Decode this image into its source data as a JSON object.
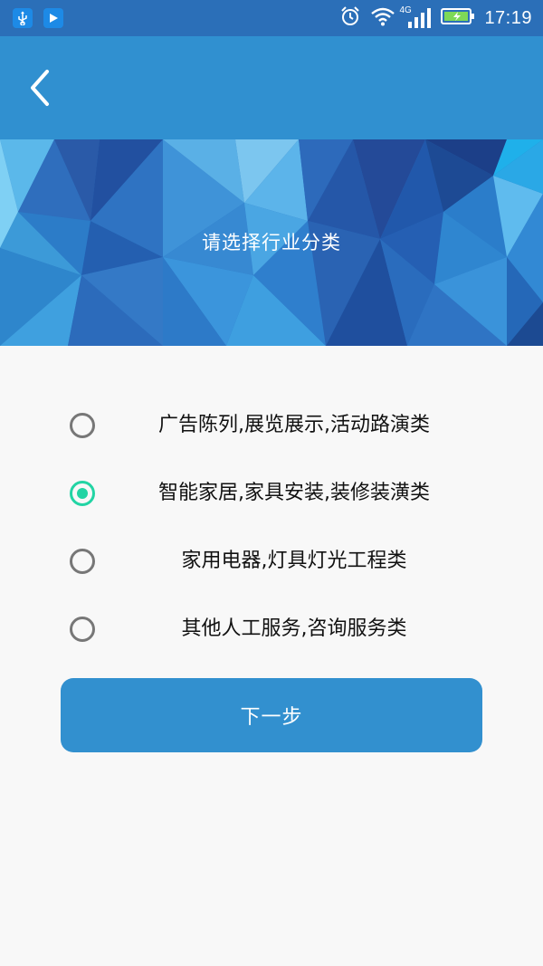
{
  "status_bar": {
    "time": "17:19",
    "network": "4G",
    "icons": [
      "usb-icon",
      "play-store-icon",
      "alarm-icon",
      "wifi-icon",
      "signal-icon",
      "battery-charging-icon"
    ]
  },
  "app_bar": {
    "back_icon": "chevron-left-icon"
  },
  "banner": {
    "title": "请选择行业分类"
  },
  "options": [
    {
      "label": "广告陈列,展览展示,活动路演类",
      "checked": false
    },
    {
      "label": "智能家居,家具安装,装修装潢类",
      "checked": true
    },
    {
      "label": "家用电器,灯具灯光工程类",
      "checked": false
    },
    {
      "label": "其他人工服务,咨询服务类",
      "checked": false
    }
  ],
  "next_button": {
    "label": "下一步"
  },
  "colors": {
    "status_bar": "#2b6fb8",
    "app_bar": "#3090d0",
    "button": "#3290cf",
    "radio_checked": "#22d4a4",
    "radio_unchecked": "#777777",
    "background": "#f8f8f8"
  }
}
